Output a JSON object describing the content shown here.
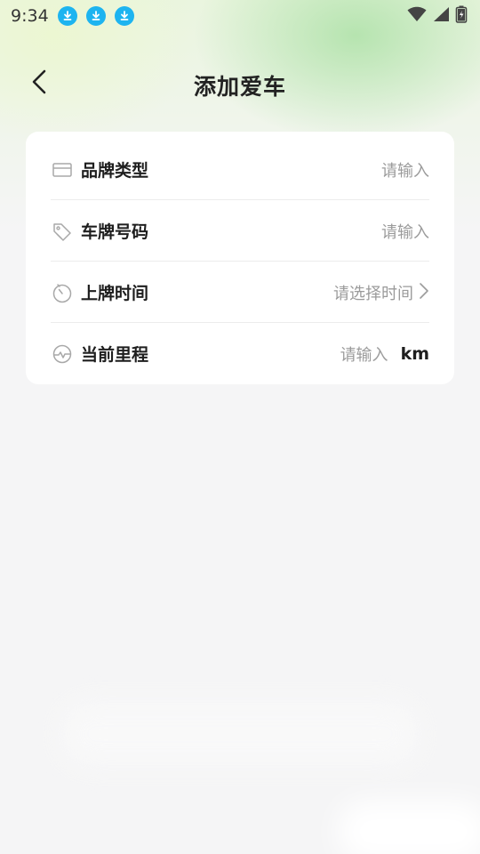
{
  "status_bar": {
    "time": "9:34",
    "download_icons": [
      "download-icon",
      "download-icon",
      "download-icon"
    ],
    "accent": "#1db4f0"
  },
  "header": {
    "title": "添加爱车",
    "back_icon": "chevron-left-icon"
  },
  "form": {
    "rows": [
      {
        "icon": "card-icon",
        "label": "品牌类型",
        "placeholder": "请输入"
      },
      {
        "icon": "tag-icon",
        "label": "车牌号码",
        "placeholder": "请输入"
      },
      {
        "icon": "clock-icon",
        "label": "上牌时间",
        "placeholder": "请选择时间",
        "trailing_icon": "chevron-right-icon"
      },
      {
        "icon": "gauge-icon",
        "label": "当前里程",
        "placeholder": "请输入",
        "unit": "km"
      }
    ]
  }
}
